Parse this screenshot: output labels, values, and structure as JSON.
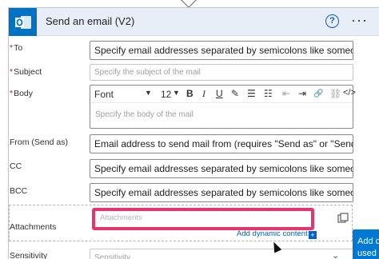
{
  "header": {
    "title": "Send an email (V2)",
    "help": "?",
    "more": "···"
  },
  "fields": {
    "to": {
      "label": "To",
      "required": "*",
      "value": "Specify email addresses separated by semicolons like someone@c..."
    },
    "subject": {
      "label": "Subject",
      "required": "*",
      "placeholder": "Specify the subject of the mail"
    },
    "body": {
      "label": "Body",
      "required": "*",
      "toolbar": {
        "font": "Font",
        "size": "12",
        "bold": "B",
        "italic": "I",
        "underline": "U",
        "paint": "✎",
        "bullets": "☰",
        "numbers": "☷",
        "outdent": "⇤",
        "indent": "⇥",
        "link": "🔗",
        "unlink": "⛓",
        "code": "</>"
      },
      "placeholder": "Specify the body of the mail"
    },
    "from": {
      "label": "From (Send as)",
      "value": "Email address to send mail from (requires \"Send as\" or \"Send on b..."
    },
    "cc": {
      "label": "CC",
      "value": "Specify email addresses separated by semicolons like someone@c..."
    },
    "bcc": {
      "label": "BCC",
      "value": "Specify email addresses separated by semicolons like someone@c..."
    },
    "attachments": {
      "label": "Attachments",
      "placeholder": "Attachments",
      "add_dynamic": "Add dynamic content",
      "add_dynamic_icon": "+"
    },
    "sensitivity": {
      "label": "Sensitivity",
      "placeholder": "Sensitivity"
    }
  },
  "popup": {
    "line1": "Add c",
    "line2": "used"
  },
  "colors": {
    "accent": "#0072c6",
    "highlight": "#e8336d",
    "required": "#a4262c"
  }
}
